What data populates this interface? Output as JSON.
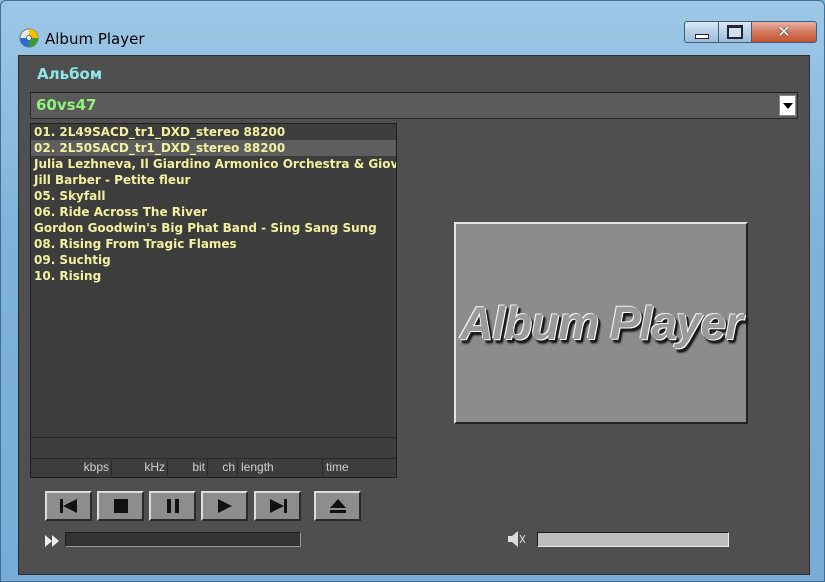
{
  "window": {
    "title": "Album Player",
    "close_glyph": "✕"
  },
  "album": {
    "label": "Альбом",
    "selected": "60vs47"
  },
  "playlist": {
    "tracks": [
      "01. 2L49SACD_tr1_DXD_stereo 88200",
      "02. 2L50SACD_tr1_DXD_stereo 88200",
      "Julia Lezhneva, Il Giardino Armonico Orchestra & Giovan",
      "Jill Barber - Petite fleur",
      "05. Skyfall",
      "06. Ride Across The River",
      "Gordon Goodwin's Big Phat Band - Sing Sang Sung",
      "08. Rising From Tragic Flames",
      "09. Suchtig",
      "10. Rising"
    ],
    "selected_index": 1
  },
  "stats": {
    "kbps": "kbps",
    "khz": "kHz",
    "bit": "bit",
    "ch": "ch",
    "length": "length",
    "time": "time"
  },
  "artwork": {
    "text": "Album Player"
  },
  "controls": {
    "icons": [
      "skip-previous-icon",
      "stop-icon",
      "pause-icon",
      "play-icon",
      "skip-next-icon",
      "eject-icon"
    ]
  },
  "playback": {
    "progress": 0,
    "volume": 1.0
  },
  "colors": {
    "track_text": "#f3f1a0",
    "album_value": "#90f27a",
    "album_label": "#8fe7ea",
    "background": "#4f4f4f"
  }
}
